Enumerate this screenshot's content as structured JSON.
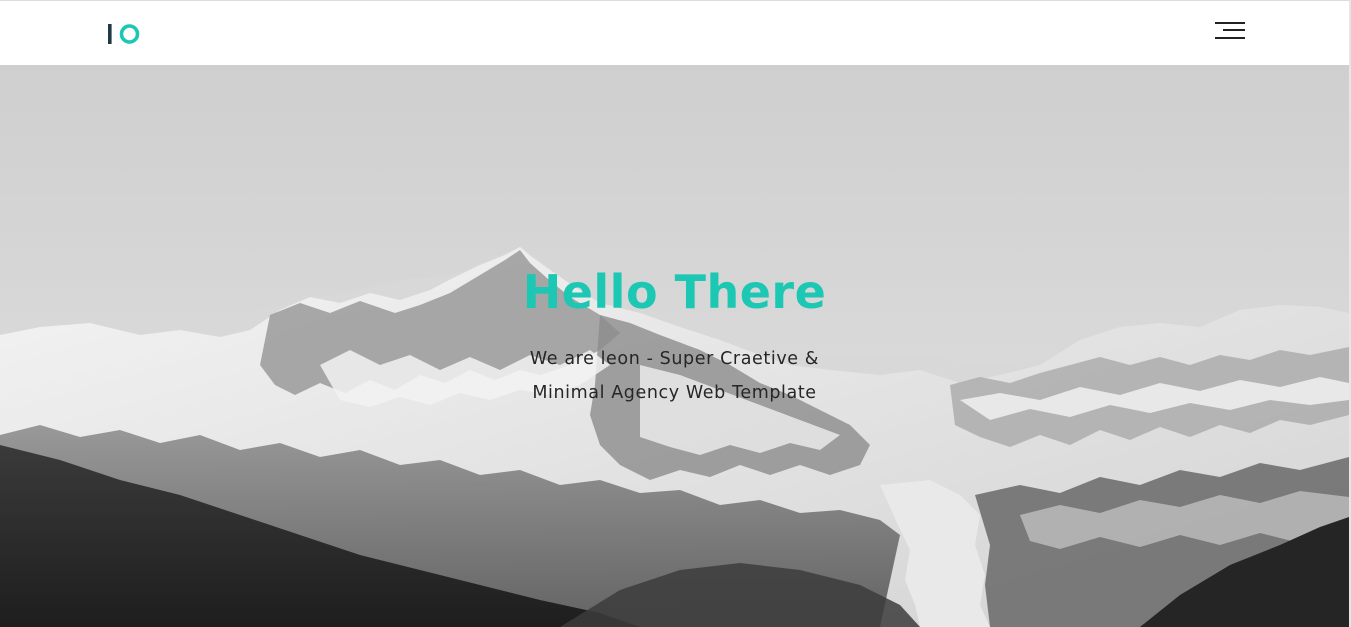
{
  "header": {
    "logo_text": "IO",
    "menu_icon": "hamburger-menu-icon"
  },
  "hero": {
    "title": "Hello There",
    "subtitle_line1": "We are leon - Super Craetive &",
    "subtitle_line2": "Minimal Agency Web Template"
  },
  "colors": {
    "accent": "#1cc7b3",
    "logo_bar": "#1f3a44",
    "text_dark": "#262626",
    "header_bg": "#ffffff"
  }
}
